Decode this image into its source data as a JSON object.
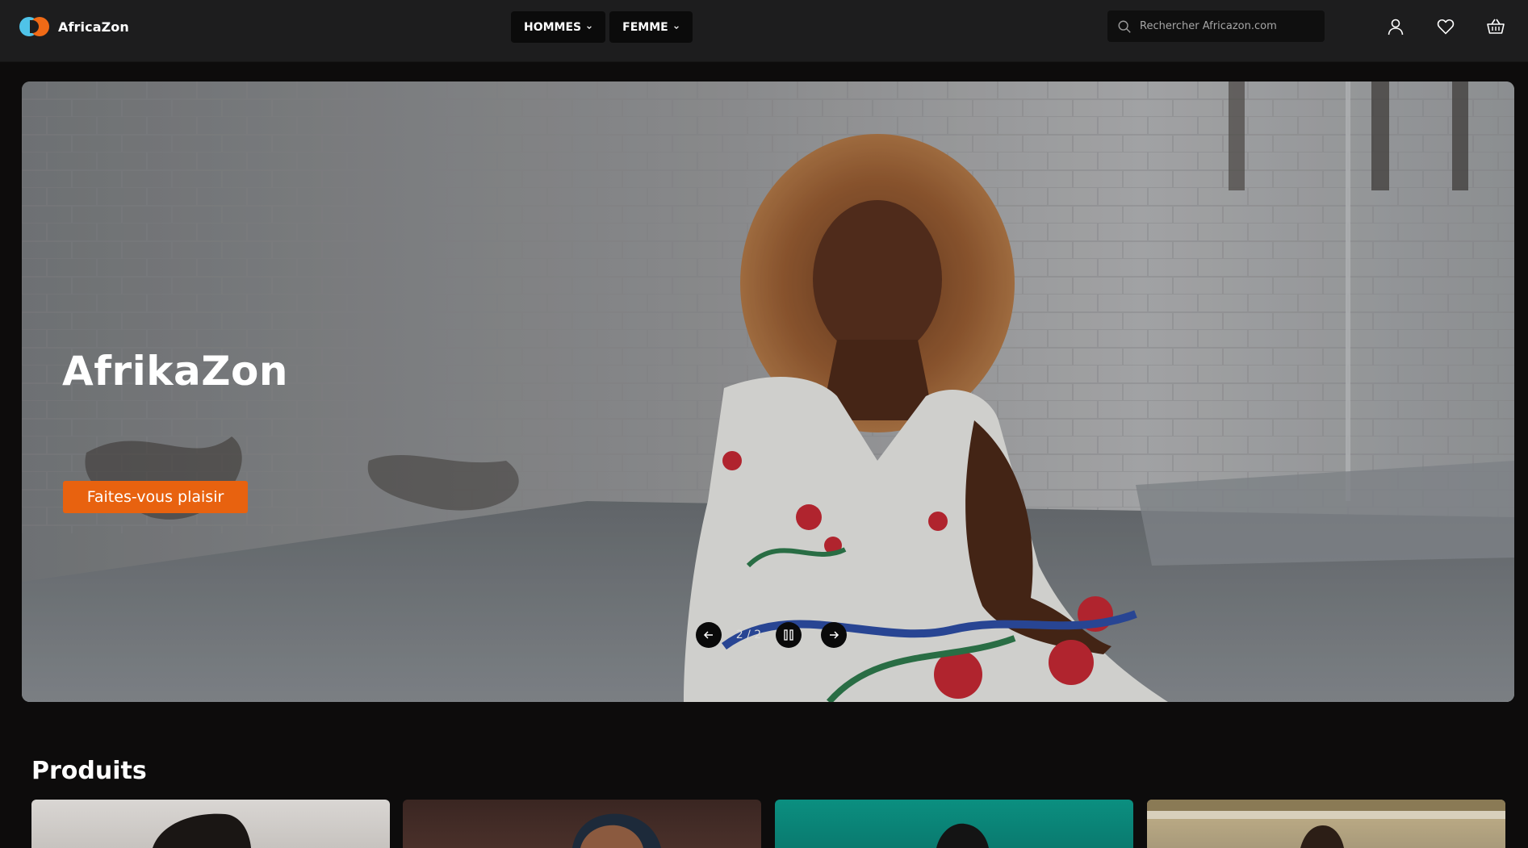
{
  "header": {
    "brand": "AfricaZon",
    "nav": [
      {
        "label": "HOMMES"
      },
      {
        "label": "FEMME"
      }
    ],
    "search_placeholder": "Rechercher Africazon.com",
    "icons": [
      "user-icon",
      "heart-icon",
      "basket-icon"
    ]
  },
  "hero": {
    "title": "AfrikaZon",
    "cta_label": "Faites-vous plaisir",
    "slide_counter": "2 / 2"
  },
  "products": {
    "title": "Produits"
  },
  "colors": {
    "accent": "#e8620f",
    "logo_blue": "#4fc3e8",
    "logo_orange": "#f06a16",
    "header_bg": "#1d1d1e",
    "page_bg": "#0d0c0c"
  }
}
